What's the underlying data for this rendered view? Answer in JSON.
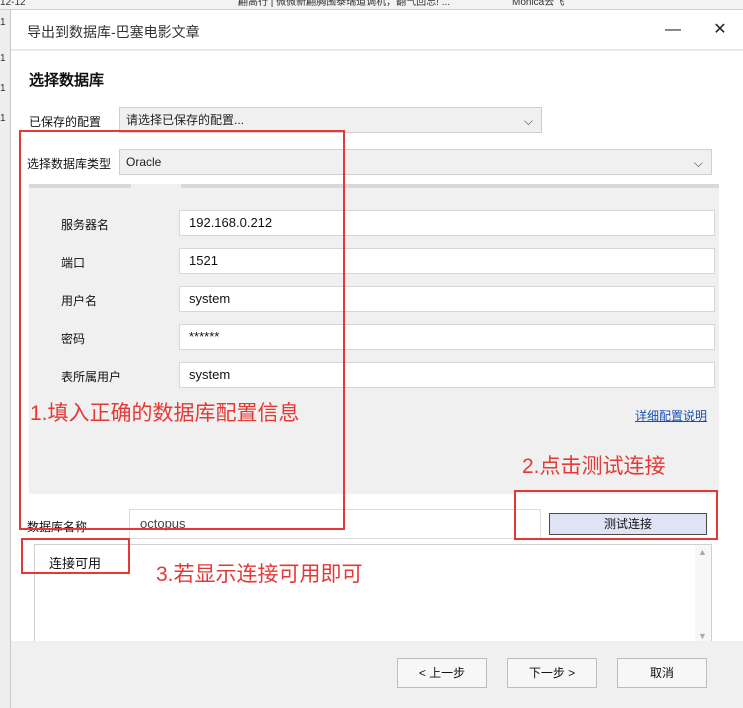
{
  "background_strip": {
    "left_text": "12-12",
    "middle_text": "翩高行 | 微微新翩胸围泰瑞道调机，翻气回忘! ...",
    "right_text": "Monica去飞",
    "edge_marks": [
      "1",
      "1",
      "1",
      "1"
    ]
  },
  "dialog": {
    "title": "导出到数据库-巴塞电影文章",
    "minimize_symbol": "—",
    "close_symbol": "✕"
  },
  "section": {
    "title": "选择数据库"
  },
  "saved_config": {
    "label": "已保存的配置",
    "placeholder": "请选择已保存的配置..."
  },
  "db_type": {
    "label": "选择数据库类型",
    "value": "Oracle"
  },
  "fields": {
    "server": {
      "label": "服务器名",
      "value": "192.168.0.212"
    },
    "port": {
      "label": "端口",
      "value": "1521"
    },
    "username": {
      "label": "用户名",
      "value": "system"
    },
    "password": {
      "label": "密码",
      "value": "******"
    },
    "table_owner": {
      "label": "表所属用户",
      "value": "system"
    }
  },
  "help_link": "详细配置说明",
  "db_name": {
    "label": "数据库名称",
    "value": "octopus"
  },
  "test_button": "测试连接",
  "result": {
    "text": "连接可用"
  },
  "footer": {
    "prev": "上一步",
    "next": "下一步",
    "cancel": "取消"
  },
  "annotations": {
    "step1": "1.填入正确的数据库配置信息",
    "step2": "2.点击测试连接",
    "step3": "3.若显示连接可用即可"
  },
  "colors": {
    "annotation": "#e53935",
    "link": "#1a4fb4",
    "panel_bg": "#f0f0f0"
  }
}
